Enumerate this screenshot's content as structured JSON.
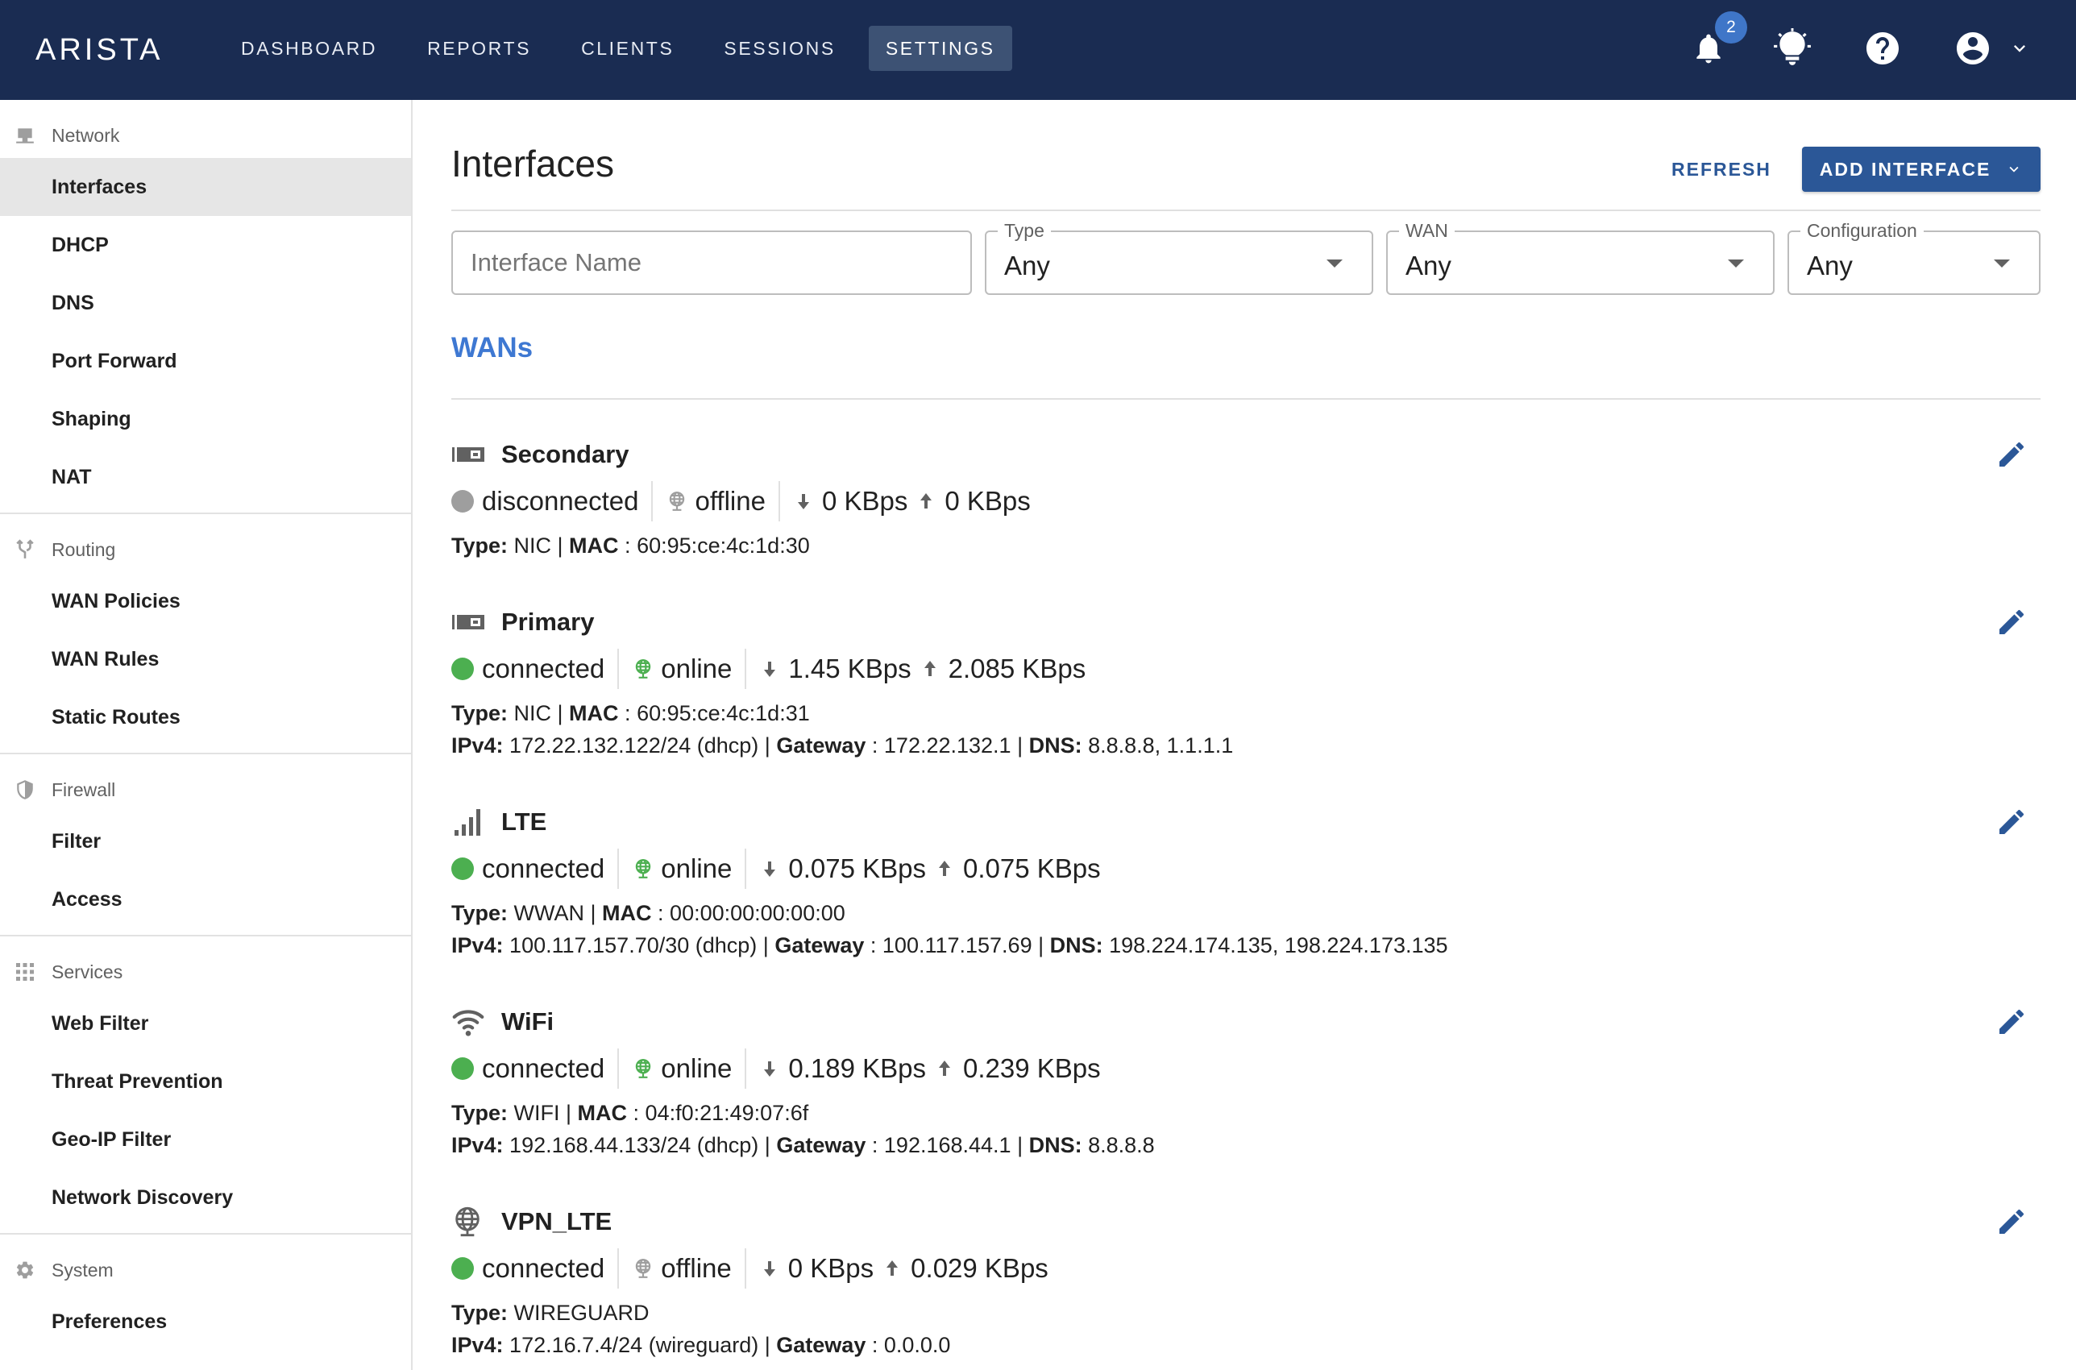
{
  "brand": "ARISTA",
  "nav": {
    "items": [
      "DASHBOARD",
      "REPORTS",
      "CLIENTS",
      "SESSIONS",
      "SETTINGS"
    ],
    "active": "SETTINGS"
  },
  "topbar": {
    "notification_count": "2",
    "icons": [
      "bell-icon",
      "lightbulb-icon",
      "help-icon",
      "account-icon",
      "chevron-down-icon"
    ]
  },
  "sidebar": {
    "network": {
      "label": "Network",
      "icon": "computer-icon",
      "items": [
        "Interfaces",
        "DHCP",
        "DNS",
        "Port Forward",
        "Shaping",
        "NAT"
      ]
    },
    "routing": {
      "label": "Routing",
      "icon": "fork-icon",
      "items": [
        "WAN Policies",
        "WAN Rules",
        "Static Routes"
      ]
    },
    "firewall": {
      "label": "Firewall",
      "icon": "shield-icon",
      "items": [
        "Filter",
        "Access"
      ]
    },
    "services": {
      "label": "Services",
      "icon": "apps-grid-icon",
      "items": [
        "Web Filter",
        "Threat Prevention",
        "Geo-IP Filter",
        "Network Discovery"
      ]
    },
    "system": {
      "label": "System",
      "icon": "gear-icon",
      "items": [
        "Preferences"
      ]
    },
    "active_item": "Interfaces"
  },
  "page": {
    "title": "Interfaces",
    "refresh_label": "REFRESH",
    "add_label": "ADD INTERFACE"
  },
  "filters": {
    "name_placeholder": "Interface Name",
    "type": {
      "label": "Type",
      "value": "Any"
    },
    "wan": {
      "label": "WAN",
      "value": "Any"
    },
    "configuration": {
      "label": "Configuration",
      "value": "Any"
    }
  },
  "section_title": "WANs",
  "colors": {
    "topbar": "#1a2c52",
    "accent": "#2b5797",
    "section": "#3e78d2",
    "connected": "#4caf50",
    "disconnected": "#9e9e9e",
    "online_globe": "#4caf50",
    "offline_globe": "#9e9e9e"
  },
  "interfaces": [
    {
      "name": "Secondary",
      "icon": "ethernet-port-icon",
      "connection": "disconnected",
      "internet": "offline",
      "down": "0 KBps",
      "up": "0 KBps",
      "type": "NIC",
      "mac": "60:95:ce:4c:1d:30"
    },
    {
      "name": "Primary",
      "icon": "ethernet-port-icon",
      "connection": "connected",
      "internet": "online",
      "down": "1.45 KBps",
      "up": "2.085 KBps",
      "type": "NIC",
      "mac": "60:95:ce:4c:1d:31",
      "ipv4": "172.22.132.122/24 (dhcp)",
      "gateway": "172.22.132.1",
      "dns": "8.8.8.8, 1.1.1.1"
    },
    {
      "name": "LTE",
      "icon": "signal-bars-icon",
      "connection": "connected",
      "internet": "online",
      "down": "0.075 KBps",
      "up": "0.075 KBps",
      "type": "WWAN",
      "mac": "00:00:00:00:00:00",
      "ipv4": "100.117.157.70/30 (dhcp)",
      "gateway": "100.117.157.69",
      "dns": "198.224.174.135, 198.224.173.135"
    },
    {
      "name": "WiFi",
      "icon": "wifi-icon",
      "connection": "connected",
      "internet": "online",
      "down": "0.189 KBps",
      "up": "0.239 KBps",
      "type": "WIFI",
      "mac": "04:f0:21:49:07:6f",
      "ipv4": "192.168.44.133/24 (dhcp)",
      "gateway": "192.168.44.1",
      "dns": "8.8.8.8"
    },
    {
      "name": "VPN_LTE",
      "icon": "globe-icon",
      "connection": "connected",
      "internet": "offline",
      "down": "0 KBps",
      "up": "0.029 KBps",
      "type": "WIREGUARD",
      "ipv4": "172.16.7.4/24 (wireguard)",
      "gateway": "0.0.0.0"
    }
  ],
  "labels": {
    "type": "Type:",
    "mac": "MAC",
    "ipv4": "IPv4:",
    "gateway": "Gateway",
    "dns": "DNS:",
    "pipe": " | ",
    "colon": " : "
  }
}
